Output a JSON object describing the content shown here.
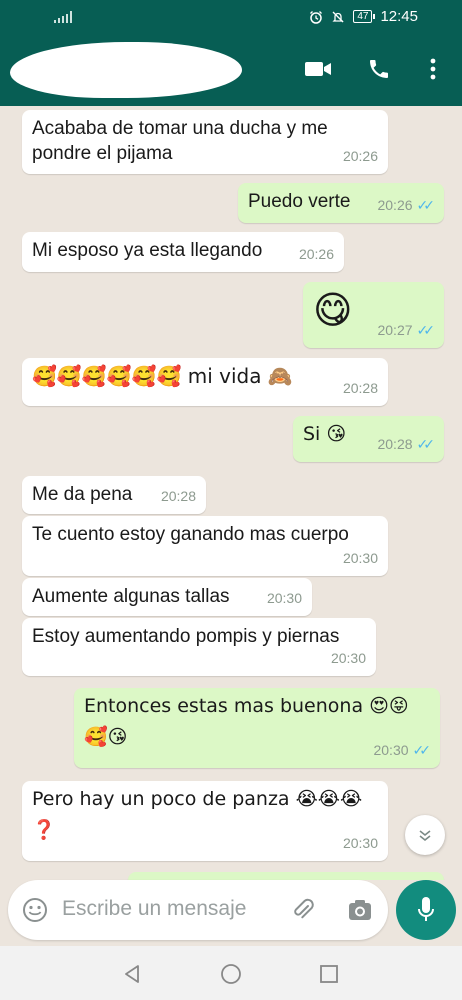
{
  "statusbar": {
    "time": "12:45",
    "battery": "47"
  },
  "header": {
    "contact_name": ""
  },
  "messages": [
    {
      "dir": "in",
      "text": "Acababa de tomar una ducha y me pondre el pijama",
      "time": "20:26"
    },
    {
      "dir": "out",
      "text": "Puedo verte",
      "time": "20:26",
      "ticks": "✓✓"
    },
    {
      "dir": "in",
      "text": "Mi esposo ya esta llegando",
      "time": "20:26"
    },
    {
      "dir": "out",
      "text": "😋",
      "time": "20:27",
      "ticks": "✓✓"
    },
    {
      "dir": "in",
      "text": "🥰🥰🥰🥰🥰🥰 mi vida 🙈",
      "time": "20:28"
    },
    {
      "dir": "out",
      "text": "Si 😘",
      "time": "20:28",
      "ticks": "✓✓"
    },
    {
      "dir": "in",
      "text": "Me da pena",
      "time": "20:28"
    },
    {
      "dir": "in",
      "text": "Te cuento estoy ganando mas cuerpo",
      "time": "20:30"
    },
    {
      "dir": "in",
      "text": "Aumente algunas tallas",
      "time": "20:30"
    },
    {
      "dir": "in",
      "text": "Estoy aumentando pompis y piernas",
      "time": "20:30"
    },
    {
      "dir": "out",
      "text": "Entonces estas mas buenona 😍😝",
      "text2": "🥰😘",
      "time": "20:30",
      "ticks": "✓✓"
    },
    {
      "dir": "in",
      "text": "Pero hay un poco de panza 😭😭😭",
      "text2": "❓",
      "time": "20:30"
    }
  ],
  "input": {
    "placeholder": "Escribe un mensaje"
  },
  "colors": {
    "header": "#075e54",
    "outgoing": "#dcf8c6",
    "incoming": "#ffffff",
    "accent": "#128c7e",
    "read_ticks": "#4fb6ec"
  },
  "icons": {
    "header": [
      "video-call-icon",
      "phone-icon",
      "more-options-icon"
    ],
    "input": [
      "emoji-icon",
      "attach-icon",
      "camera-icon",
      "mic-icon"
    ],
    "nav": [
      "back-nav-icon",
      "home-nav-icon",
      "recents-nav-icon"
    ]
  }
}
